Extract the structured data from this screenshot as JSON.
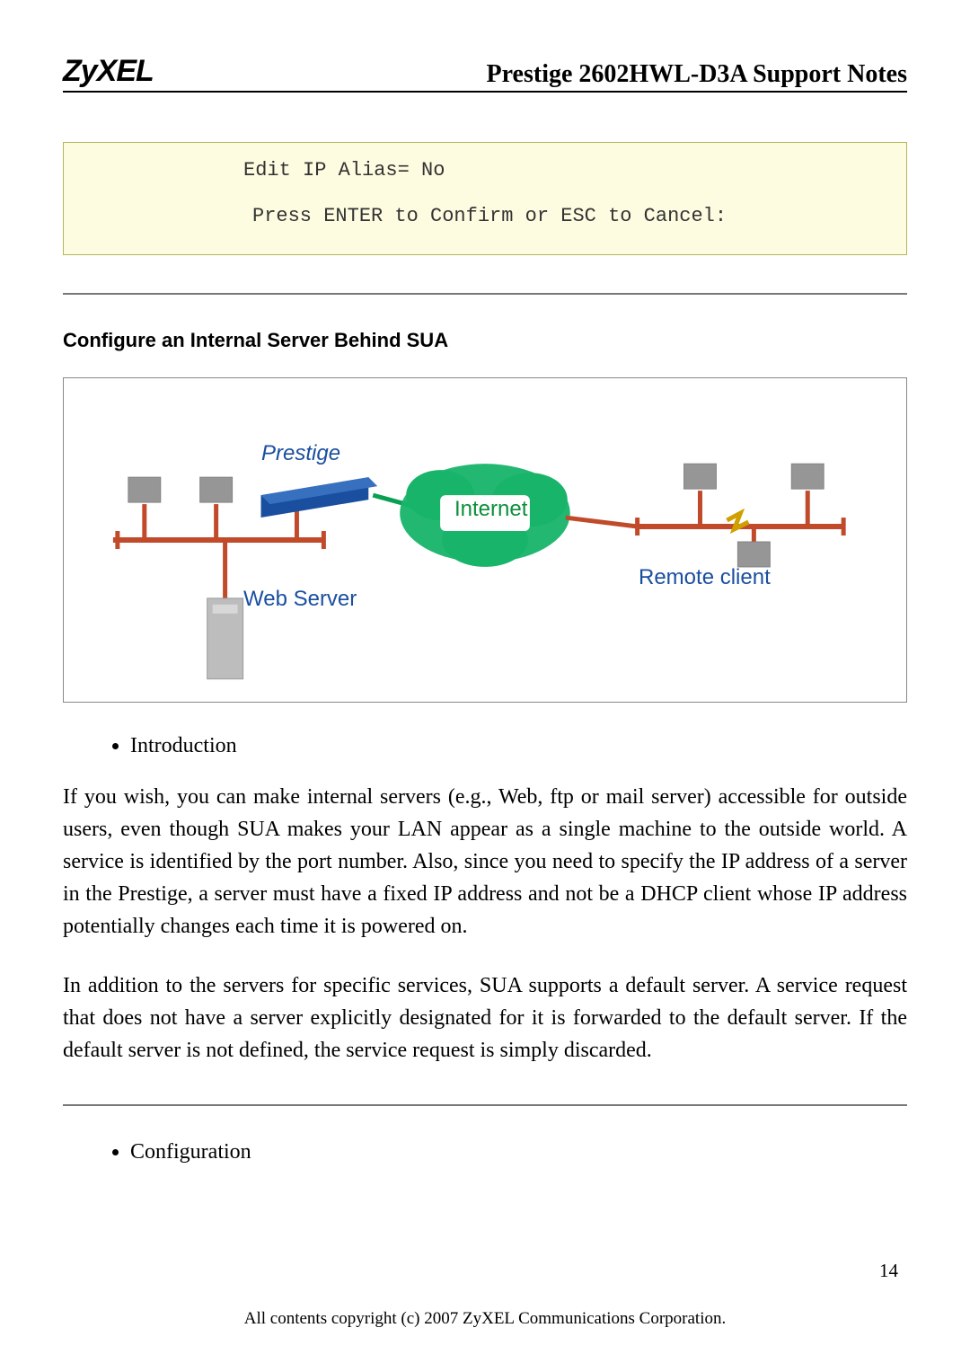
{
  "header": {
    "logo": "ZyXEL",
    "title": "Prestige 2602HWL-D3A Support Notes"
  },
  "terminal": {
    "line1": "Edit IP Alias= No",
    "line2": "Press ENTER to Confirm or ESC to Cancel:"
  },
  "section": {
    "heading": "Configure an Internal Server Behind SUA"
  },
  "diagram": {
    "prestige": "Prestige",
    "internet": "Internet",
    "remote": "Remote client",
    "webserver": "Web Server"
  },
  "bullets": {
    "introduction": "Introduction",
    "configuration": "Configuration"
  },
  "paragraphs": {
    "p1": "If you wish, you can make internal servers (e.g., Web, ftp or mail server) accessible for outside users, even though SUA makes your LAN appear as a single machine to the outside world. A service is identified by the port number. Also, since you need to specify the IP address of a server in the Prestige, a server must have a fixed IP address and not be a DHCP client whose IP address potentially changes each time it is powered on.",
    "p2": "In addition to the servers for specific services, SUA supports a default server. A service request that does not have a server explicitly designated for it is forwarded to the default server. If the default server is not defined, the service request is simply discarded."
  },
  "footer": {
    "page": "14",
    "copyright": "All contents copyright (c) 2007 ZyXEL Communications Corporation."
  }
}
